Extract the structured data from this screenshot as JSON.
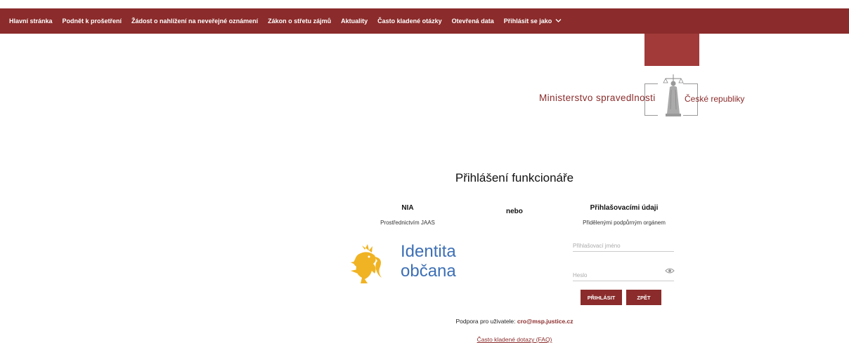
{
  "nav": {
    "items": [
      {
        "label": "Hlavní stránka"
      },
      {
        "label": "Podnět k prošetření"
      },
      {
        "label": "Žádost o nahlížení na neveřejné oznámení"
      },
      {
        "label": "Zákon o střetu zájmů"
      },
      {
        "label": "Aktuality"
      },
      {
        "label": "Často kladené otázky"
      },
      {
        "label": "Otevřená data"
      },
      {
        "label": "Přihlásit se jako"
      }
    ]
  },
  "logo": {
    "left_text": "Ministerstvo spravedlnosti",
    "right_text": "České republiky"
  },
  "page_title": "Přihlášení funkcionáře",
  "nia": {
    "title": "NIA",
    "subtitle": "Prostřednictvím JAAS",
    "brand_line1": "Identita",
    "brand_line2": "občana"
  },
  "separator": "nebo",
  "credentials": {
    "title": "Přihlašovacími údaji",
    "subtitle": "Přidělenými podpůrným orgánem",
    "username_placeholder": "Přihlašovací jméno",
    "password_placeholder": "Heslo",
    "login_button": "PŘIHLÁSIT",
    "back_button": "ZPĚT"
  },
  "support": {
    "label": "Podpora pro uživatele: ",
    "email": "cro@msp.justice.cz"
  },
  "faq_link": "Často kladené dotazy (FAQ)",
  "colors": {
    "brand": "#8b2b2b",
    "identita_blue": "#3d6fb5",
    "lion_gold": "#f0b323"
  }
}
